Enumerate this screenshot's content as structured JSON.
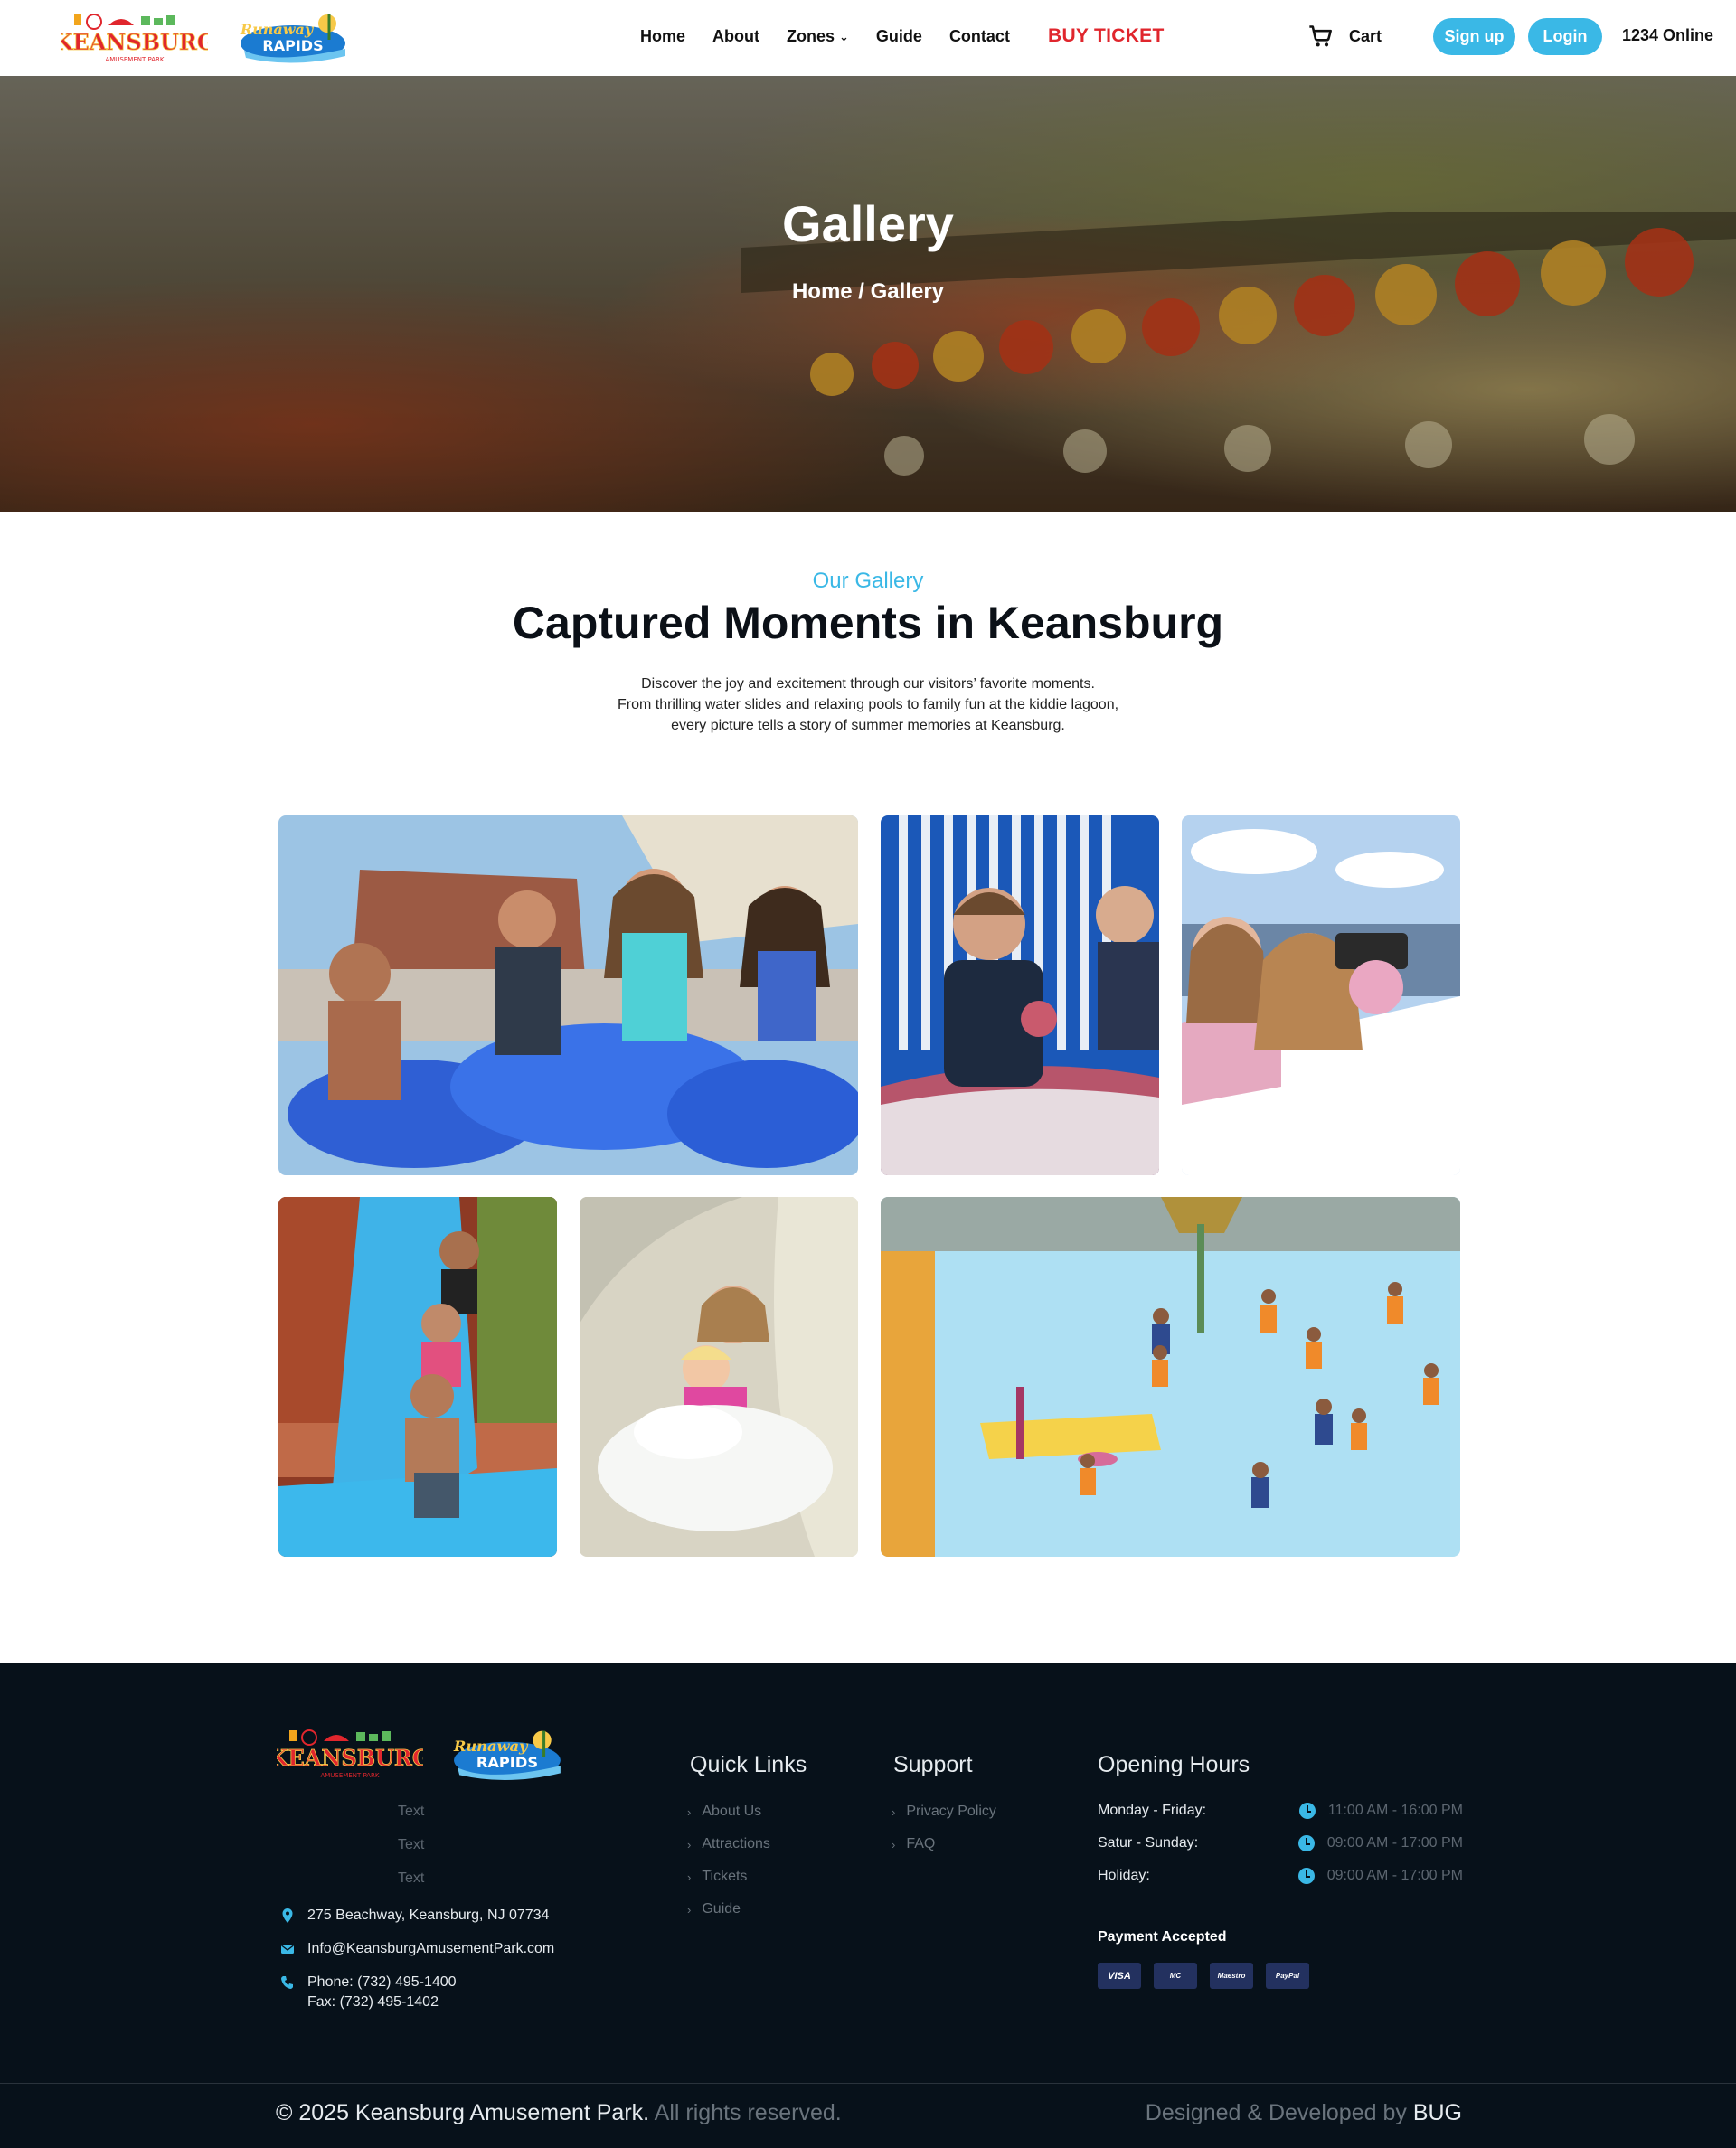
{
  "nav": {
    "links": [
      "Home",
      "About",
      "Zones",
      "Guide",
      "Contact"
    ],
    "buy_ticket": "BUY TICKET",
    "cart": "Cart",
    "signup": "Sign up",
    "login": "Login",
    "online": "1234 Online"
  },
  "brand": {
    "keansburg_logo_text": "KEANSBURG",
    "keansburg_logo_sub": "AMUSEMENT PARK",
    "rapids_logo_text_1": "Runaway",
    "rapids_logo_text_2": "RAPIDS"
  },
  "hero": {
    "title": "Gallery",
    "breadcrumb": "Home / Gallery"
  },
  "intro": {
    "eyebrow": "Our Gallery",
    "headline": "Captured Moments in Keansburg",
    "lines": [
      "Discover the joy and excitement through our visitors’ favorite moments.",
      "From thrilling water slides and relaxing pools to family fun at the kiddie lagoon,",
      "every picture tells a story of summer memories at Keansburg."
    ]
  },
  "gallery": {
    "photos": [
      "water-park-tubes",
      "kiddie-boat-ride",
      "kiddie-plane-ride",
      "family-water-slide",
      "splash-slide",
      "kiddie-lagoon-crowd"
    ]
  },
  "footer": {
    "placeholder_texts": [
      "Text",
      "Text",
      "Text"
    ],
    "address": "275 Beachway, Keansburg, NJ 07734",
    "email": "Info@KeansburgAmusementPark.com",
    "phone": "Phone: (732) 495-1400",
    "fax": "Fax: (732) 495-1402",
    "quick_links": {
      "title": "Quick Links",
      "items": [
        "About Us",
        "Attractions",
        "Tickets",
        "Guide"
      ]
    },
    "support": {
      "title": "Support",
      "items": [
        "Privacy Policy",
        "FAQ"
      ]
    },
    "hours": {
      "title": "Opening Hours",
      "rows": [
        {
          "day": "Monday - Friday:",
          "time": "11:00 AM - 16:00 PM"
        },
        {
          "day": "Satur - Sunday:",
          "time": "09:00 AM - 17:00 PM"
        },
        {
          "day": "Holiday:",
          "time": "09:00 AM - 17:00 PM"
        }
      ]
    },
    "payment": {
      "title": "Payment Accepted",
      "cards": [
        "VISA",
        "MC",
        "Maestro",
        "PayPal"
      ]
    },
    "copyright_main": "© 2025 Keansburg Amusement Park.",
    "copyright_rest": " All rights reserved.",
    "credits_prefix": "Designed & Developed by ",
    "credits_brand": "BUG"
  },
  "colors": {
    "accent": "#3ab8e6",
    "buy_ticket": "#e0262d",
    "footer_bg": "#07111a"
  }
}
